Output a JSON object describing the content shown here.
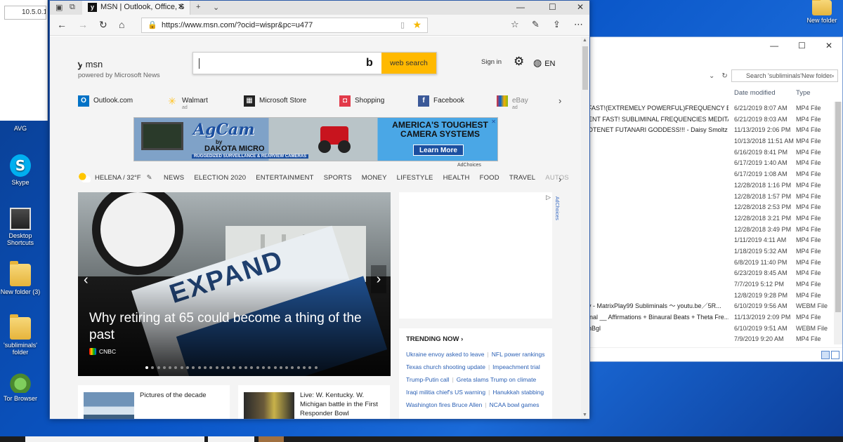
{
  "desktop": {
    "left_icons": [
      {
        "name": "AVG",
        "label": "AVG"
      },
      {
        "name": "skype",
        "label": "Skype"
      },
      {
        "name": "desktop-shortcuts",
        "label": "Desktop Shortcuts"
      },
      {
        "name": "new-folder-3",
        "label": "New folder (3)"
      },
      {
        "name": "subliminals-folder",
        "label": "'subliminals' folder"
      },
      {
        "name": "tor-browser",
        "label": "Tor Browser"
      }
    ],
    "right_icon": {
      "label": "New folder"
    },
    "back_window_address": "10.5.0.1"
  },
  "explorer": {
    "search_placeholder": "Search 'subliminals'New folder",
    "headers": {
      "date": "Date modified",
      "type": "Type"
    },
    "rows": [
      {
        "name": "FAST!(EXTREMELY POWERFUL)FREQUENCY BINA...",
        "date": "6/21/2019 8:07 AM",
        "type": "MP4 File"
      },
      {
        "name": "ENT FAST! SUBLIMINAL FREQUENCIES MEDITATI...",
        "date": "6/21/2019 8:03 AM",
        "type": "MP4 File"
      },
      {
        "name": "OTENET FUTANARI GODDESS!!! - Daisy Smoltz Su...",
        "date": "11/13/2019 2:06 PM",
        "type": "MP4 File"
      },
      {
        "name": "",
        "date": "10/13/2018 11:51 AM",
        "type": "MP4 File"
      },
      {
        "name": "",
        "date": "6/16/2019 8:41 PM",
        "type": "MP4 File"
      },
      {
        "name": "",
        "date": "6/17/2019 1:40 AM",
        "type": "MP4 File"
      },
      {
        "name": "",
        "date": "6/17/2019 1:08 AM",
        "type": "MP4 File"
      },
      {
        "name": "",
        "date": "12/28/2018 1:16 PM",
        "type": "MP4 File"
      },
      {
        "name": "",
        "date": "12/28/2018 1:57 PM",
        "type": "MP4 File"
      },
      {
        "name": "",
        "date": "12/28/2018 2:53 PM",
        "type": "MP4 File"
      },
      {
        "name": "",
        "date": "12/28/2018 3:21 PM",
        "type": "MP4 File"
      },
      {
        "name": "",
        "date": "12/28/2018 3:49 PM",
        "type": "MP4 File"
      },
      {
        "name": "",
        "date": "1/11/2019 4:11 AM",
        "type": "MP4 File"
      },
      {
        "name": "",
        "date": "1/18/2019 5:32 AM",
        "type": "MP4 File"
      },
      {
        "name": "",
        "date": "6/8/2019 11:40 PM",
        "type": "MP4 File"
      },
      {
        "name": "",
        "date": "6/23/2019 8:45 AM",
        "type": "MP4 File"
      },
      {
        "name": "",
        "date": "7/7/2019 5:12 PM",
        "type": "MP4 File"
      },
      {
        "name": "",
        "date": "12/8/2019 9:28 PM",
        "type": "MP4 File"
      },
      {
        "name": "y - MatrixPlay99 Subliminals ～ youtu.be／5R...",
        "date": "6/10/2019 9:56 AM",
        "type": "WEBM File"
      },
      {
        "name": "inal __ Affirmations + Binaural Beats + Theta Fre...",
        "date": "11/13/2019 2:09 PM",
        "type": "MP4 File"
      },
      {
        "name": "nBgl",
        "date": "6/10/2019 9:51 AM",
        "type": "WEBM File"
      },
      {
        "name": "",
        "date": "7/9/2019 9:20 AM",
        "type": "MP4 File"
      }
    ]
  },
  "browser": {
    "tab_title": "MSN | Outlook, Office, S",
    "url": "https://www.msn.com/?ocid=wispr&pc=u477"
  },
  "msn": {
    "logo": "msn",
    "powered": "powered by Microsoft News",
    "search_button": "web search",
    "signin": "Sign in",
    "lang": "EN",
    "shortcuts": [
      {
        "name": "outlook",
        "label": "Outlook.com",
        "ad": ""
      },
      {
        "name": "walmart",
        "label": "Walmart",
        "ad": "ad"
      },
      {
        "name": "microsoft-store",
        "label": "Microsoft Store",
        "ad": ""
      },
      {
        "name": "shopping",
        "label": "Shopping",
        "ad": ""
      },
      {
        "name": "facebook",
        "label": "Facebook",
        "ad": ""
      },
      {
        "name": "ebay",
        "label": "eBay",
        "ad": "ad"
      }
    ],
    "banner": {
      "brand": "AgCam",
      "by": "by",
      "maker": "DAKOTA MICRO",
      "tagline": "RUGGEDIZED SURVEILLANCE & REARVIEW CAMERAS",
      "headline": "AMERICA'S TOUGHEST CAMERA SYSTEMS",
      "cta": "Learn More"
    },
    "adchoices": "AdChoices",
    "weather": "HELENA / 32°F",
    "categories": [
      "NEWS",
      "ELECTION 2020",
      "ENTERTAINMENT",
      "SPORTS",
      "MONEY",
      "LIFESTYLE",
      "HEALTH",
      "FOOD",
      "TRAVEL",
      "AUTOS"
    ],
    "hero": {
      "sign_text": "EXPAND",
      "title": "Why retiring at 65 could become a thing of the past",
      "source": "CNBC",
      "slide_count": 30,
      "active_slide": 1
    },
    "trending": {
      "heading": "TRENDING NOW",
      "rows": [
        [
          "Ukraine envoy asked to leave",
          "NFL power rankings"
        ],
        [
          "Texas church shooting update",
          "Impeachment trial"
        ],
        [
          "Trump-Putin call",
          "Greta slams Trump on climate"
        ],
        [
          "Iraqi militia chief's US warning",
          "Hanukkah stabbing"
        ],
        [
          "Washington fires Bruce Allen",
          "NCAA bowl games"
        ]
      ]
    },
    "cards": [
      {
        "title": "Pictures of the decade"
      },
      {
        "title": "Live: W. Kentucky. W. Michigan battle in the First Responder Bowl"
      }
    ]
  }
}
